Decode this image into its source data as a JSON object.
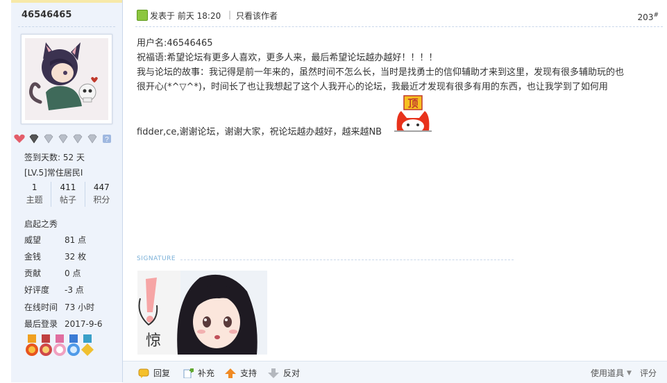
{
  "user": {
    "username": "46546465",
    "stats": {
      "checkin_label": "签到天数: 52 天",
      "level_label": "[LV.5]常住居民I"
    },
    "counts": [
      {
        "value": "1",
        "label": "主题"
      },
      {
        "value": "411",
        "label": "帖子"
      },
      {
        "value": "447",
        "label": "积分"
      }
    ],
    "rank_title": "启起之秀",
    "info": [
      {
        "key": "威望",
        "value": "81 点"
      },
      {
        "key": "金钱",
        "value": "32 枚"
      },
      {
        "key": "贡献",
        "value": "0 点"
      },
      {
        "key": "好评度",
        "value": "-3 点"
      },
      {
        "key": "在线时间",
        "value": "73 小时"
      },
      {
        "key": "最后登录",
        "value": "2017-9-6"
      }
    ],
    "colors": {
      "panel_bg": "#eef3fb",
      "border": "#c9d7ea"
    }
  },
  "post": {
    "meta": "发表于  前天 18:20",
    "only_author": "只看该作者",
    "floor": "203",
    "floor_mark": "#",
    "lines": [
      "用户名:46546465",
      "祝福语:希望论坛有更多人喜欢，更多人来，最后希望论坛越办越好！！！！",
      "我与论坛的故事：我记得是前一年来的，虽然时间不怎么长，当时是找勇士的信仰辅助才来到这里，发现有很多辅助玩的也",
      "很开心(*^▽^*)，时间长了也让我想起了这个人我开心的论坛，我最近才发现有很多有用的东西，也让我学到了如何用",
      "fidder,ce,谢谢论坛，谢谢大家，祝论坛越办越好，越来越NB"
    ],
    "emoji_text": "顶",
    "signature_label": "SIGNATURE",
    "signature_image_text": "惊"
  },
  "actions": {
    "reply": "回复",
    "supplement": "补充",
    "support": "支持",
    "oppose": "反对",
    "tools": "使用道具",
    "rate": "评分"
  }
}
